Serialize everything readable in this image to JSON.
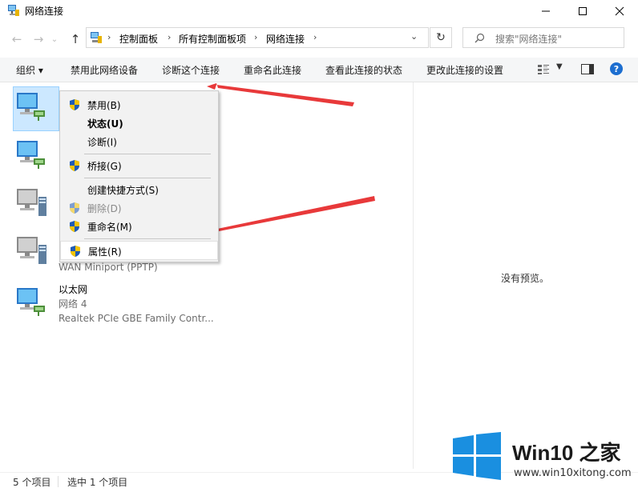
{
  "window": {
    "title": "网络连接",
    "minimize_icon": "minimize-icon",
    "maximize_icon": "maximize-icon",
    "close_icon": "close-icon"
  },
  "nav": {
    "back_icon": "arrow-left-icon",
    "forward_icon": "arrow-right-icon",
    "recent_icon": "chevron-down-icon",
    "up_icon": "arrow-up-icon"
  },
  "address": {
    "crumbs": [
      "控制面板",
      "所有控制面板项",
      "网络连接"
    ],
    "dropdown_icon": "chevron-down-icon",
    "refresh_icon": "refresh-icon"
  },
  "search": {
    "placeholder": "搜索\"网络连接\""
  },
  "toolbar": {
    "organize": "组织 ▾",
    "disable": "禁用此网络设备",
    "diagnose": "诊断这个连接",
    "rename": "重命名此连接",
    "view_status": "查看此连接的状态",
    "change_settings": "更改此连接的设置"
  },
  "connections": [
    {
      "name": "",
      "network": "",
      "device": ""
    },
    {
      "name": "",
      "network": "",
      "device": ""
    },
    {
      "name": "",
      "network": "",
      "device": ""
    },
    {
      "name": "",
      "network": "",
      "device": "WAN Miniport (PPTP)"
    },
    {
      "name": "以太网",
      "network": "网络 4",
      "device": "Realtek PCIe GBE Family Contr..."
    }
  ],
  "context_menu": {
    "items": [
      {
        "label": "禁用(B)",
        "shield": true,
        "bold": false,
        "disabled": false
      },
      {
        "label": "状态(U)",
        "shield": false,
        "bold": true,
        "disabled": false
      },
      {
        "label": "诊断(I)",
        "shield": false,
        "bold": false,
        "disabled": false
      },
      {
        "label": "桥接(G)",
        "shield": true,
        "bold": false,
        "disabled": false
      },
      {
        "label": "创建快捷方式(S)",
        "shield": false,
        "bold": false,
        "disabled": false
      },
      {
        "label": "删除(D)",
        "shield": true,
        "bold": false,
        "disabled": true
      },
      {
        "label": "重命名(M)",
        "shield": true,
        "bold": false,
        "disabled": false
      },
      {
        "label": "属性(R)",
        "shield": true,
        "bold": false,
        "disabled": false
      }
    ]
  },
  "preview": {
    "text": "没有预览。"
  },
  "status": {
    "count": "5 个项目",
    "selected": "选中 1 个项目"
  },
  "watermark": {
    "brand": "Win10 之家",
    "url": "www.win10xitong.com"
  },
  "colors": {
    "accent": "#0078d7",
    "arrow": "#e8393a",
    "selection": "#cce8ff"
  }
}
